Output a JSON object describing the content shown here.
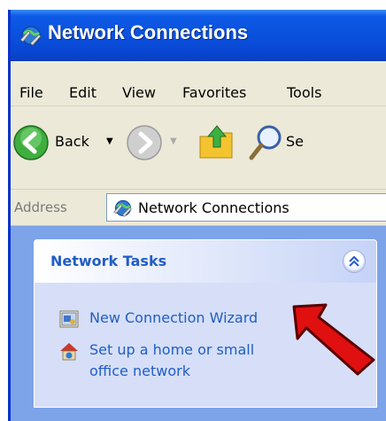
{
  "window": {
    "title": "Network Connections",
    "icon": "network-connections-icon"
  },
  "menu": [
    "File",
    "Edit",
    "View",
    "Favorites",
    "Tools"
  ],
  "toolbar": {
    "back_label": "Back",
    "back_icon": "back-arrow-icon",
    "forward_icon": "forward-arrow-icon",
    "up_icon": "folder-up-icon",
    "search_icon": "search-icon",
    "search_label_partial": "Se"
  },
  "address": {
    "label": "Address",
    "value": "Network Connections",
    "icon": "network-connections-icon"
  },
  "task_panel": {
    "title": "Network Tasks",
    "collapse_icon": "chevron-up-double-icon",
    "items": [
      {
        "label": "New Connection Wizard",
        "icon": "new-connection-wizard-icon"
      },
      {
        "label_line1": "Set up a home or small",
        "label_line2": "office network",
        "icon": "home-network-icon"
      }
    ]
  },
  "annotation": {
    "icon": "red-arrow-pointer"
  },
  "colors": {
    "title_bar": "#0a4fdc",
    "menu_bg": "#ece9d8",
    "pane_bg": "#7da3e8",
    "task_bg": "#d6dff7",
    "link": "#215dc6",
    "arrow": "#e01010"
  }
}
